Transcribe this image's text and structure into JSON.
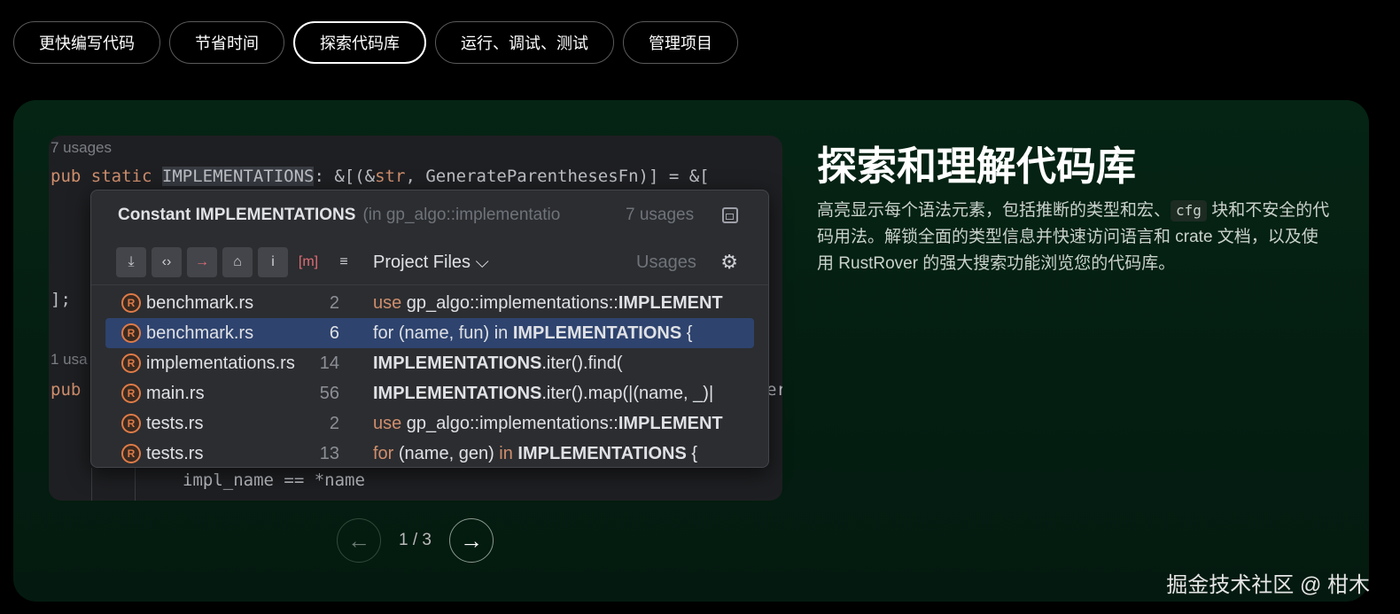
{
  "tabs": [
    "更快编写代码",
    "节省时间",
    "探索代码库",
    "运行、调试、测试",
    "管理项目"
  ],
  "active_tab": "探索代码库",
  "editor": {
    "usages_top": "7 usages",
    "line1_kw1": "pub",
    "line1_kw2": "static",
    "line1_ident": "IMPLEMENTATIONS",
    "line1_mid": ": &[(&",
    "line1_str": "str",
    "line1_rest": ", GenerateParenthesesFn)] = &[",
    "line_close": "];",
    "usages_lower": "1 usa",
    "line_pub2": "pub",
    "line_er": "er",
    "line_impl": "impl_name == *name"
  },
  "popup": {
    "title": "Constant IMPLEMENTATIONS",
    "subtitle": "(in gp_algo::implementatio",
    "count": "7 usages",
    "scope": "Project Files ⌵",
    "usages_label": "Usages",
    "tool_icons": [
      "⤓",
      "‹›",
      "→",
      "⌂",
      "i",
      "[m]",
      "≡"
    ],
    "rows": [
      {
        "file": "benchmark.rs",
        "line": "2",
        "pre_kw": "use",
        "pre": " gp_algo::implementations::",
        "bold": "IMPLEMENT",
        "post": ""
      },
      {
        "file": "benchmark.rs",
        "line": "6",
        "pre_kw": "",
        "pre": "for (name, fun) in ",
        "bold": "IMPLEMENTATIONS",
        "post": " {"
      },
      {
        "file": "implementations.rs",
        "line": "14",
        "pre_kw": "",
        "pre": "",
        "bold": "IMPLEMENTATIONS",
        "post": ".iter().find("
      },
      {
        "file": "main.rs",
        "line": "56",
        "pre_kw": "",
        "pre": "",
        "bold": "IMPLEMENTATIONS",
        "post": ".iter().map(|(name, _)|"
      },
      {
        "file": "tests.rs",
        "line": "2",
        "pre_kw": "use",
        "pre": " gp_algo::implementations::",
        "bold": "IMPLEMENT",
        "post": ""
      },
      {
        "file": "tests.rs",
        "line": "13",
        "pre_kw": "for",
        "pre": " (name, gen) ",
        "kw2": "in",
        "bold": " IMPLEMENTATIONS",
        "post": " {"
      }
    ]
  },
  "pager": {
    "prev": "←",
    "text": "1 / 3",
    "next": "→"
  },
  "heading": "探索和理解代码库",
  "desc_part1": "高亮显示每个语法元素，包括推断的类型和宏、",
  "desc_code": "cfg",
  "desc_part2": " 块和不安全的代码用法。解锁全面的类型信息并快速访问语言和 crate 文档，以及使用 RustRover 的强大搜索功能浏览您的代码库。",
  "watermark": "掘金技术社区 @ 柑木",
  "colors": {
    "panel": "#052414",
    "keyword": "#cf8e6d",
    "selection": "#2e436e",
    "rust_icon": "#e07b47"
  }
}
